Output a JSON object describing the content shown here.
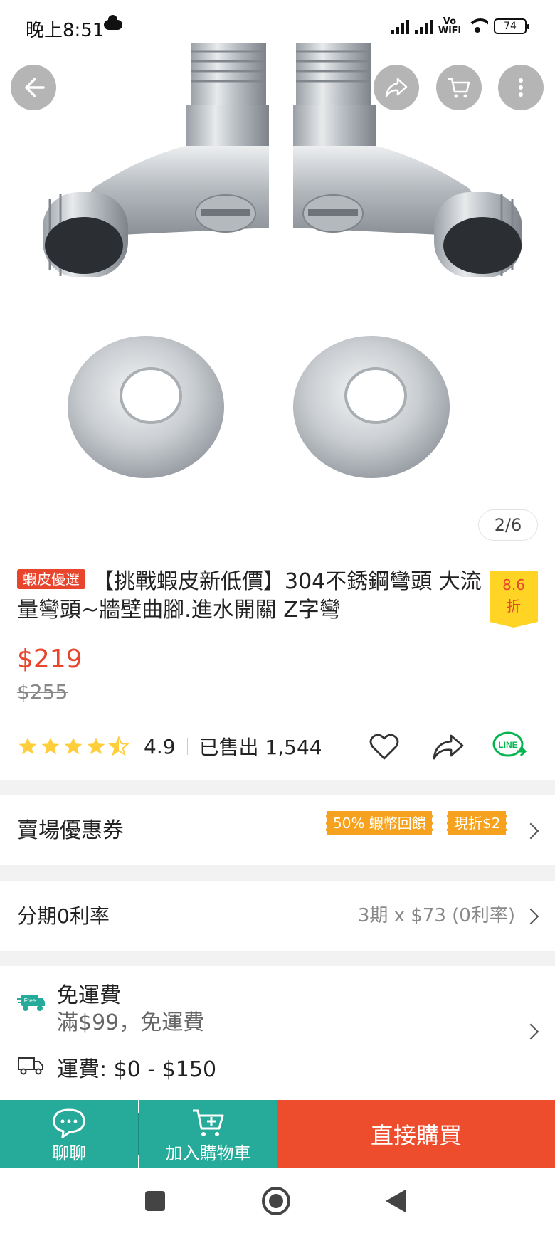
{
  "status_bar": {
    "time": "晚上8:51",
    "network": "Vo WiFi",
    "battery": "74"
  },
  "image_counter": "2/6",
  "product": {
    "mall_badge": "蝦皮優選",
    "title": "【挑戰蝦皮新低價】304不銹鋼彎頭 大流量彎頭~牆壁曲腳.進水開關 Z字彎",
    "discount": {
      "value": "8.6",
      "unit": "折"
    },
    "price": "$219",
    "original_price": "$255",
    "rating": "4.9",
    "rating_stars": 4.5,
    "sold": "已售出 1,544"
  },
  "voucher": {
    "title": "賣場優惠券",
    "tags": [
      "50% 蝦幣回饋",
      "現折$2"
    ]
  },
  "installment": {
    "title": "分期0利率",
    "value": "3期 x $73 (0利率)"
  },
  "shipping": {
    "free_title": "免運費",
    "free_sub": "滿$99，免運費",
    "fee": "運費: $0 - $150",
    "free_badge": "Free"
  },
  "actions": {
    "chat": "聊聊",
    "add_to_cart": "加入購物車",
    "buy_now": "直接購買"
  },
  "colors": {
    "brand": "#ee4d2d",
    "teal": "#26aa99",
    "star": "#ffce3d",
    "voucher": "#f6a21e"
  }
}
